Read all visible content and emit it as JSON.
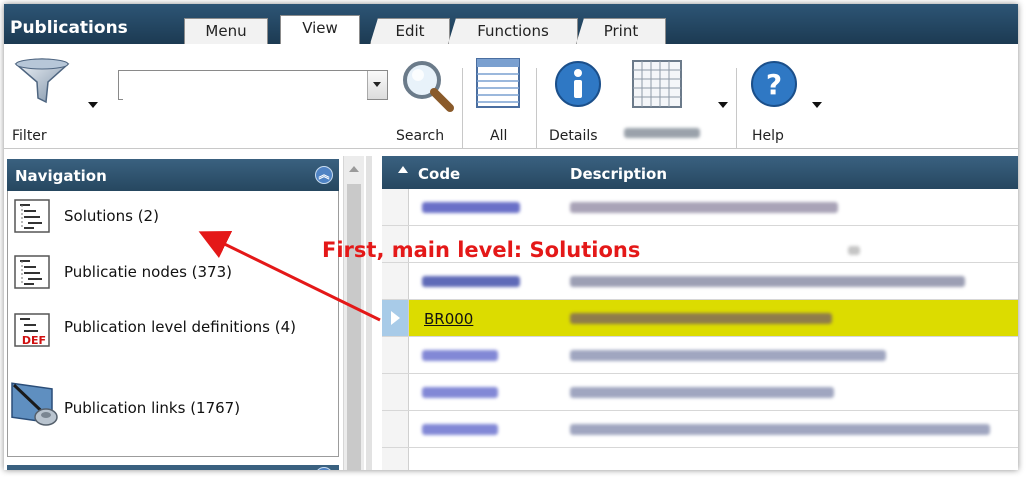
{
  "app": {
    "title": "Publications"
  },
  "tabs": [
    {
      "label": "Menu"
    },
    {
      "label": "View"
    },
    {
      "label": "Edit"
    },
    {
      "label": "Functions"
    },
    {
      "label": "Print"
    }
  ],
  "toolbar": {
    "filter_label": "Filter",
    "search_value": "",
    "search_label": "Search",
    "all_label": "All",
    "details_label": "Details",
    "help_label": "Help"
  },
  "navigation": {
    "title": "Navigation",
    "items": [
      {
        "label": "Solutions (2)",
        "icon": "tree-structure-icon"
      },
      {
        "label": "Publicatie nodes (373)",
        "icon": "tree-structure-icon"
      },
      {
        "label": "Publication level definitions (4)",
        "icon": "tree-def-icon"
      },
      {
        "label": "Publication links (1767)",
        "icon": "link-icon"
      }
    ]
  },
  "grid": {
    "columns": [
      "Code",
      "Description"
    ],
    "selected_code": "BR000",
    "row_count_visible": 7
  },
  "annotation": {
    "text": "First, main level: Solutions"
  },
  "colors": {
    "header_blue": "#2a4d68",
    "selection_yellow": "#dcdc00",
    "annotation_red": "#e41818"
  }
}
